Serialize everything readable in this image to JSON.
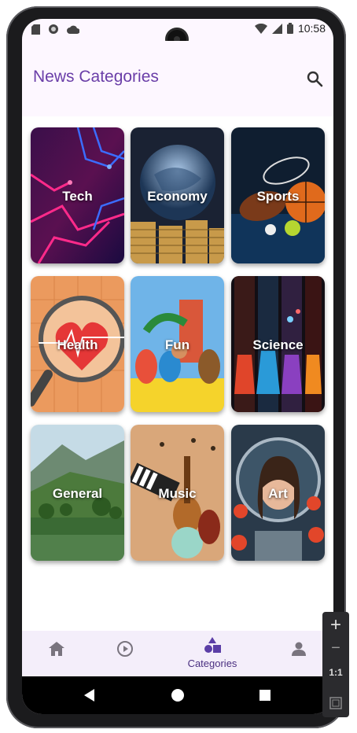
{
  "status_bar": {
    "time": "10:58",
    "left_icons": [
      "sd-card-icon",
      "record-icon",
      "cloud-icon"
    ],
    "right_icons": [
      "wifi-icon",
      "signal-icon",
      "battery-icon"
    ]
  },
  "app_bar": {
    "title": "News Categories",
    "action_icon": "search-icon"
  },
  "categories": [
    {
      "label": "Tech"
    },
    {
      "label": "Economy"
    },
    {
      "label": "Sports"
    },
    {
      "label": "Health"
    },
    {
      "label": "Fun"
    },
    {
      "label": "Science"
    },
    {
      "label": "General"
    },
    {
      "label": "Music"
    },
    {
      "label": "Art"
    }
  ],
  "bottom_nav": {
    "items": [
      {
        "icon": "home-icon",
        "label": ""
      },
      {
        "icon": "play-circle-icon",
        "label": ""
      },
      {
        "icon": "categories-icon",
        "label": "Categories",
        "selected": true
      },
      {
        "icon": "person-icon",
        "label": ""
      }
    ]
  },
  "system_nav": [
    "back-icon",
    "home-circle-icon",
    "recents-icon"
  ],
  "zoom_control": {
    "plus": "+",
    "minus": "−",
    "ratio": "1:1"
  },
  "colors": {
    "accent": "#6a3ea8",
    "surface": "#fdf7ff",
    "nav_bar": "#f4eefa",
    "selected_icon": "#5b3ea6",
    "inactive_icon": "#79747e"
  }
}
